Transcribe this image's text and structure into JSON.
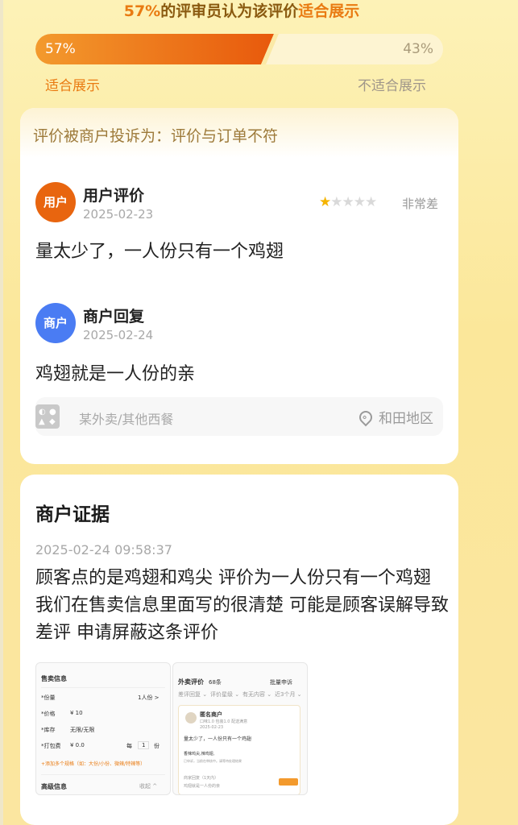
{
  "vote": {
    "title_pct": "57%",
    "title_mid": "的评审员认为该评价",
    "title_highlight": "适合展示",
    "left_percent_text": "57%",
    "right_percent_text": "43%",
    "left_fraction": 0.57,
    "left_label": "适合展示",
    "right_label": "不适合展示"
  },
  "complaint_card": {
    "complaint_text": "评价被商户投诉为：评价与订单不符",
    "user_review": {
      "avatar_text": "用户",
      "name": "用户评价",
      "date": "2025-02-23",
      "stars_filled": 1,
      "stars_total": 5,
      "rating_text": "非常差",
      "content": "量太少了，一人份只有一个鸡翅"
    },
    "merchant_reply": {
      "avatar_text": "商户",
      "name": "商户回复",
      "date": "2025-02-24",
      "content": "鸡翅就是一人份的亲"
    },
    "shop": {
      "name": "某外卖/其他西餐",
      "location": "和田地区"
    }
  },
  "evidence": {
    "title": "商户证据",
    "time": "2025-02-24 09:58:37",
    "text": "顾客点的是鸡翅和鸡尖 评价为一人份只有一个鸡翅 我们在售卖信息里面写的很清楚 可能是顾客误解导致差评 申请屏蔽这条评价",
    "screenshot1": {
      "section": "售卖信息",
      "rows": [
        {
          "label": "*份量",
          "value": "1人份 >"
        },
        {
          "label": "*价格",
          "value": "¥ 10"
        },
        {
          "label": "*库存",
          "value": "无限/无限"
        },
        {
          "label": "*打包费",
          "value": "¥ 0.0"
        }
      ],
      "per_label": "每",
      "per_value": "1",
      "per_unit": "份",
      "add_link": "+添加多个规格（如：大份/小份、微辣/特辣等）",
      "section2": "高级信息",
      "collapse": "收起 ^"
    },
    "screenshot2": {
      "title": "外卖评价",
      "count": "68条",
      "batch": "批量申诉",
      "filters": [
        "差评回复 ⌄",
        "评价星级 ⌄",
        "有无内容 ⌄",
        "近3个月 ⌄"
      ],
      "reviewer": "匿名商户",
      "meta": "口味1.0  包装1.0  配送满意",
      "date": "2025-02-23",
      "content": "量太少了，一人份只有一个鸡翅",
      "dish": "香辣鸡尖,辣鸡翅,",
      "notice": "已申诉，当前在审核中。请等待处理结果",
      "reply_hint": "商家回复（1天内）",
      "reply_text": "鸡翅就是一人份的亲"
    }
  }
}
